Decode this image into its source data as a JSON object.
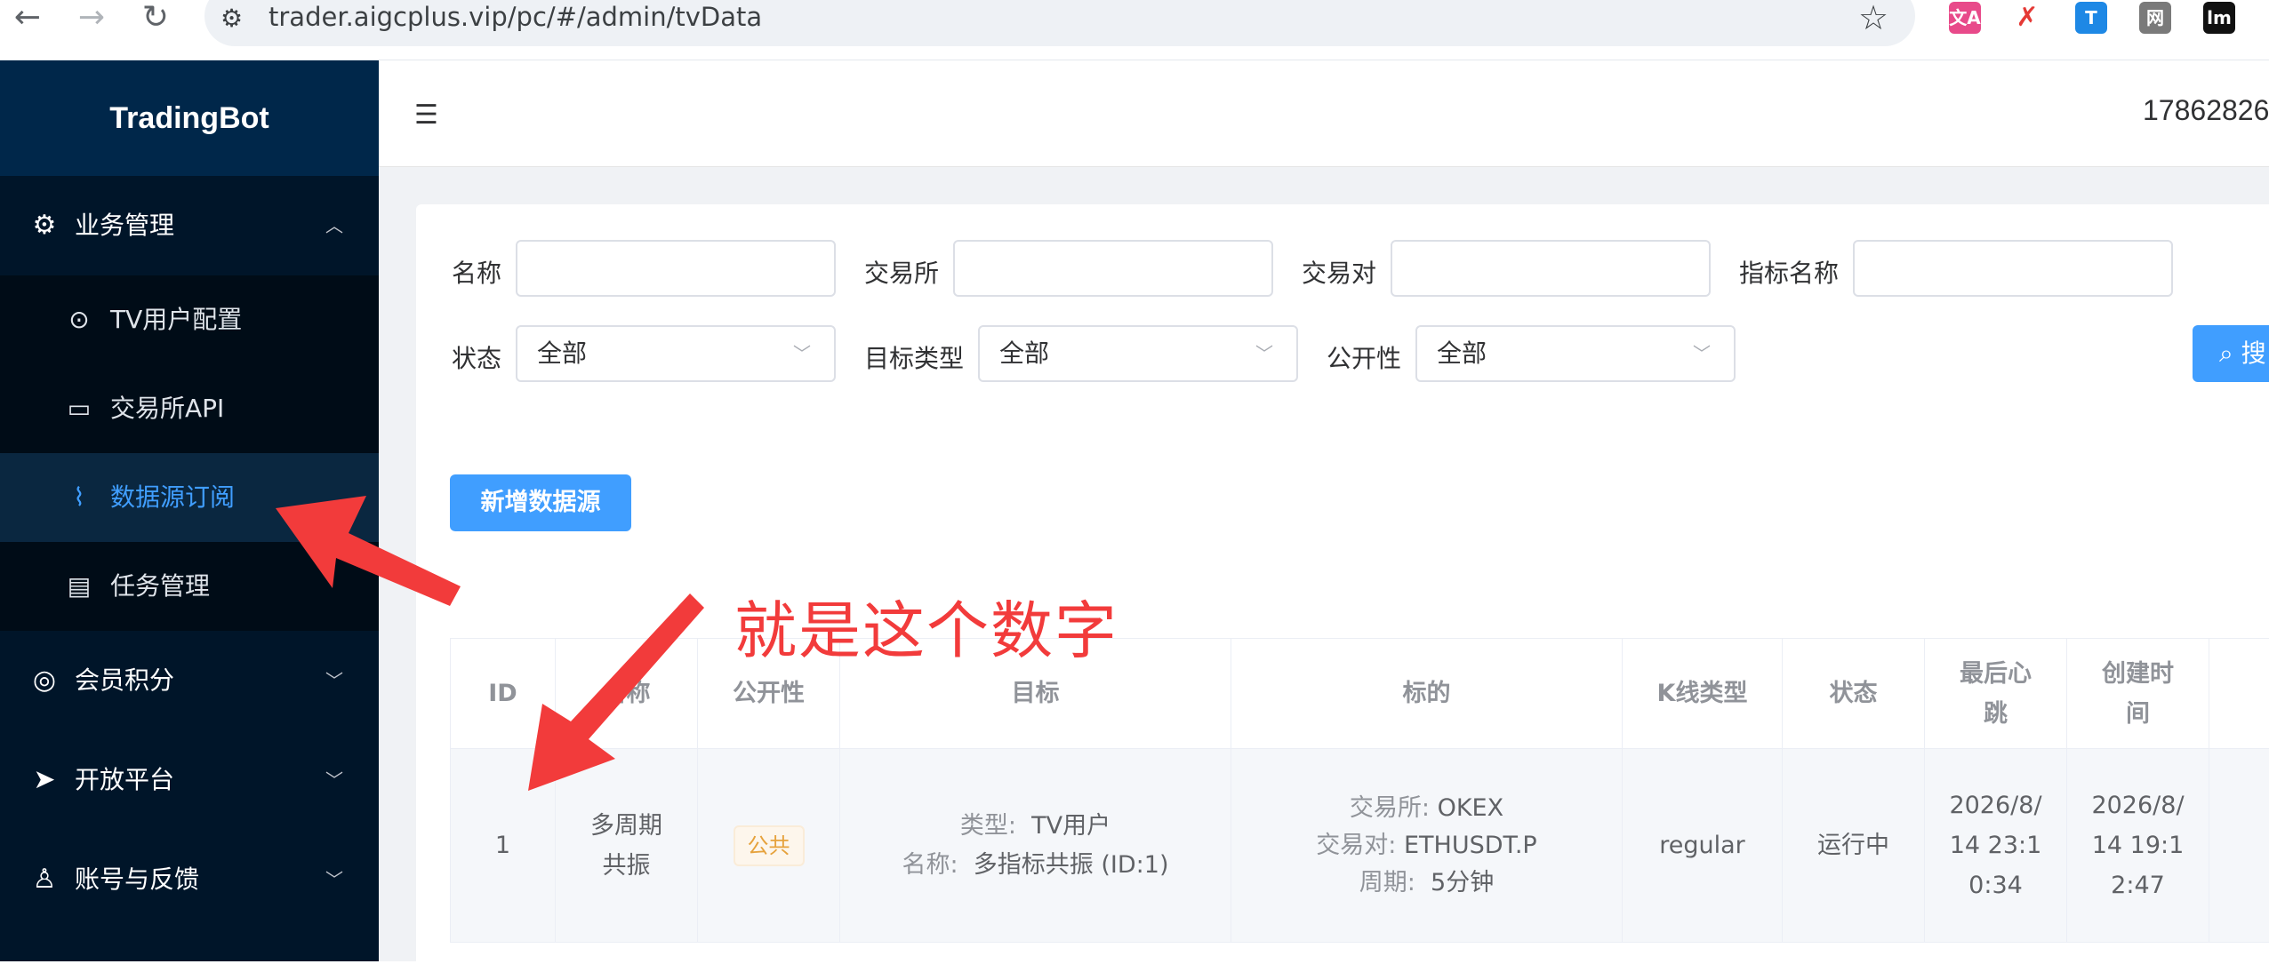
{
  "browser": {
    "url": "trader.aigcplus.vip/pc/#/admin/tvData",
    "ext_labels": [
      "文A",
      "",
      "T",
      "网",
      "lm"
    ]
  },
  "sidebar": {
    "logo": "TradingBot",
    "menus": [
      {
        "label": "业务管理",
        "icon": "gear-icon",
        "expanded": true,
        "items": [
          {
            "label": "TV用户配置",
            "icon": "user-link-icon"
          },
          {
            "label": "交易所API",
            "icon": "wallet-icon"
          },
          {
            "label": "数据源订阅",
            "icon": "chart-board-icon",
            "active": true
          },
          {
            "label": "任务管理",
            "icon": "clipboard-icon"
          }
        ]
      },
      {
        "label": "会员积分",
        "icon": "medal-icon"
      },
      {
        "label": "开放平台",
        "icon": "send-icon"
      },
      {
        "label": "账号与反馈",
        "icon": "user-icon"
      }
    ]
  },
  "header": {
    "user": "17862826"
  },
  "filters": {
    "name_label": "名称",
    "exchange_label": "交易所",
    "pair_label": "交易对",
    "indicator_label": "指标名称",
    "status_label": "状态",
    "status_value": "全部",
    "target_type_label": "目标类型",
    "target_type_value": "全部",
    "public_label": "公开性",
    "public_value": "全部",
    "search_button": "搜索"
  },
  "actions": {
    "add_button": "新增数据源"
  },
  "annotation": "就是这个数字",
  "table": {
    "headers": [
      "ID",
      "名称",
      "公开性",
      "目标",
      "标的",
      "K线类型",
      "状态",
      "最后心跳",
      "创建时间"
    ],
    "rows": [
      {
        "id": "1",
        "name": "多周期共振",
        "public": "公共",
        "target_type_label": "类型:",
        "target_type": "TV用户",
        "target_name_label": "名称:",
        "target_name": "多指标共振 (ID:1)",
        "exchange_label": "交易所:",
        "exchange": "OKEX",
        "pair_label": "交易对:",
        "pair": "ETHUSDT.P",
        "period_label": "周期:",
        "period": "5分钟",
        "kline": "regular",
        "status": "运行中",
        "heartbeat": "2026/8/14 23:10:34",
        "created": "2026/8/14 19:12:47"
      }
    ]
  },
  "colors": {
    "primary": "#409eff",
    "sidebar": "#001529",
    "arrow": "#f23b3b"
  }
}
